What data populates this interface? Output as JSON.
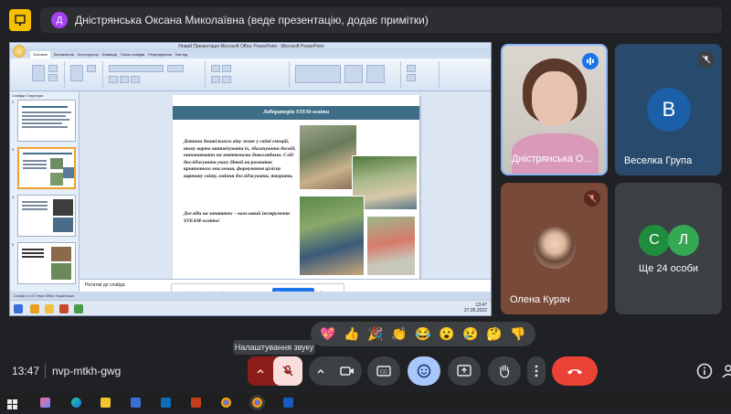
{
  "presenter": {
    "avatar_letter": "Д",
    "text": "Дністрянська Оксана Миколаївна (веде презентацію, додає примітки)"
  },
  "ppt": {
    "window_title": "Новий Презентація Microsoft Office PowerPoint - Microsoft PowerPoint",
    "ribbon_tabs": [
      "Основне",
      "Вставлення",
      "Конструктор",
      "Анімація",
      "Показ слайдів",
      "Рецензування",
      "Вигляд"
    ],
    "panel_tabs": "Слайди  Структура",
    "thumb_numbers": [
      "2",
      "3",
      "4",
      "5"
    ],
    "slide": {
      "title": "Лабораторія STEM-освіти",
      "paragraph1": "Дитина дошкільного віку живе у світі емоцій, тому варто активізувати їх, збагачувати досвід, наповнювати на миттєвими дивоглядами. Слід досліджувати увагу дітей на розвиток критичного мислення, формування цілісну картину світу, вміння досліджувати, творити.",
      "paragraph2": "Досліди на заняттях – важливий інструмент STEAM-освіти!"
    },
    "notes_placeholder": "Нотатки до слайда",
    "share_popup_text": "meet.google.com spільний доступ до вашого екрана",
    "share_stop_button": "Більше не ділитися",
    "share_hide_button": "Сховати",
    "statusbar": "Слайд 4 із 5    Тема Office    Українська",
    "clock": "13:47",
    "date": "27.05.2022"
  },
  "participants": [
    {
      "name": "Дністрянська О...",
      "kind": "video",
      "speaking": true
    },
    {
      "name": "Веселка Група",
      "kind": "avatar",
      "letter": "B",
      "color": "#1a5fa8",
      "muted": true
    },
    {
      "name": "Олена Курач",
      "kind": "photo-avatar",
      "muted": true
    },
    {
      "name": "Ще 24 особи",
      "kind": "group",
      "letters": [
        "C",
        "Л"
      ],
      "color": "#34a853"
    }
  ],
  "reactions": [
    "💖",
    "👍",
    "🎉",
    "👏",
    "😂",
    "😮",
    "😢",
    "🤔",
    "👎"
  ],
  "tooltip": "Налаштування звуку",
  "meeting": {
    "time": "13:47",
    "code": "nvp-mtkh-gwg"
  },
  "colors": {
    "leave_red": "#ea4335",
    "active_blue": "#a8c7fa",
    "mic_red": "#f9dedc",
    "banner": "#3f6f88"
  },
  "icons": {
    "mic": "mic-off-icon",
    "camera": "camera-icon",
    "captions": "captions-icon",
    "emoji": "emoji-icon",
    "present": "present-icon",
    "hand": "raise-hand-icon",
    "more": "more-vert-icon",
    "leave": "call-end-icon",
    "info": "info-icon"
  }
}
